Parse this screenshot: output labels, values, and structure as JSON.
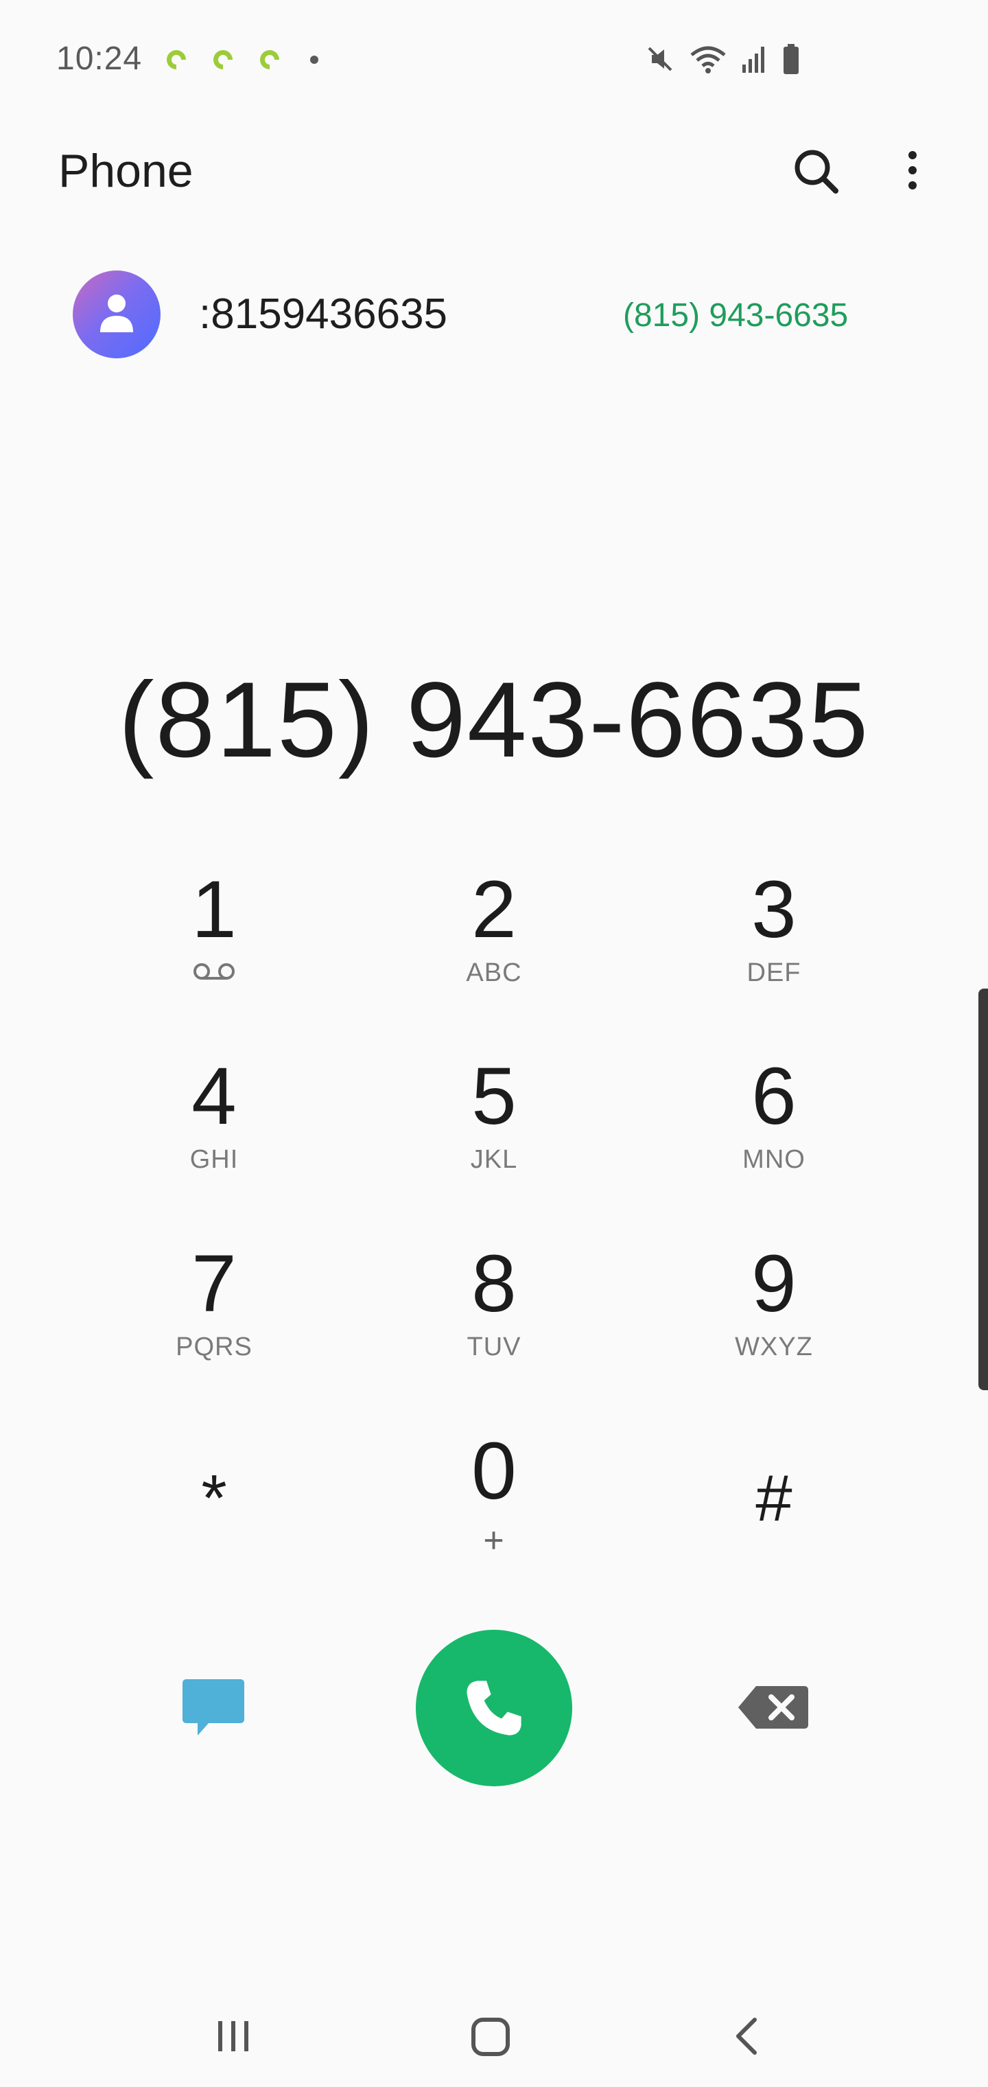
{
  "status_bar": {
    "time": "10:24",
    "notification_icons": [
      "app-notification-icon",
      "app-notification-icon",
      "app-notification-icon",
      "more-notifications-dot"
    ],
    "system_icons": [
      "mute-icon",
      "wifi-icon",
      "signal-icon",
      "battery-icon"
    ]
  },
  "app_bar": {
    "title": "Phone",
    "actions": [
      "search-icon",
      "more-options-icon"
    ]
  },
  "suggestion": {
    "name": ":8159436635",
    "number": "(815) 943-6635"
  },
  "dialer": {
    "display_number": "(815) 943-6635"
  },
  "keypad": {
    "keys": [
      {
        "digit": "1",
        "letters": ""
      },
      {
        "digit": "2",
        "letters": "ABC"
      },
      {
        "digit": "3",
        "letters": "DEF"
      },
      {
        "digit": "4",
        "letters": "GHI"
      },
      {
        "digit": "5",
        "letters": "JKL"
      },
      {
        "digit": "6",
        "letters": "MNO"
      },
      {
        "digit": "7",
        "letters": "PQRS"
      },
      {
        "digit": "8",
        "letters": "TUV"
      },
      {
        "digit": "9",
        "letters": "WXYZ"
      },
      {
        "digit": "*",
        "letters": ""
      },
      {
        "digit": "0",
        "letters": "+"
      },
      {
        "digit": "#",
        "letters": ""
      }
    ]
  },
  "actions": {
    "message_icon": "message-icon",
    "call_icon": "phone-call-icon",
    "backspace_icon": "backspace-icon"
  },
  "colors": {
    "accent_green": "#17b86b",
    "number_green": "#1f9d5c",
    "message_blue": "#4fb0d8",
    "background": "#fafafa"
  },
  "nav_bar": {
    "buttons": [
      "recents-icon",
      "home-icon",
      "back-icon"
    ]
  }
}
